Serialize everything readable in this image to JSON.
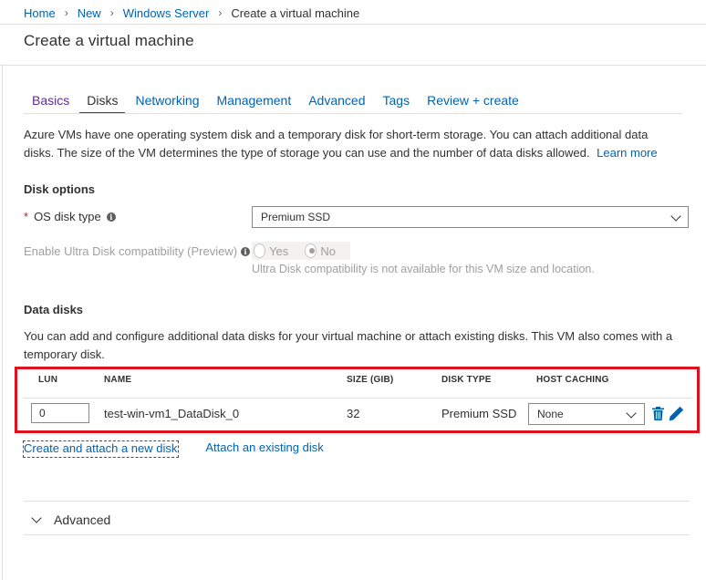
{
  "breadcrumb": {
    "items": [
      "Home",
      "New",
      "Windows Server"
    ],
    "current": "Create a virtual machine"
  },
  "page_title": "Create a virtual machine",
  "tabs": [
    {
      "label": "Basics"
    },
    {
      "label": "Disks",
      "active": true
    },
    {
      "label": "Networking"
    },
    {
      "label": "Management"
    },
    {
      "label": "Advanced"
    },
    {
      "label": "Tags"
    },
    {
      "label": "Review + create"
    }
  ],
  "intro": {
    "text": "Azure VMs have one operating system disk and a temporary disk for short-term storage. You can attach additional data disks. The size of the VM determines the type of storage you can use and the number of data disks allowed.",
    "learn_more": "Learn more"
  },
  "disk_options": {
    "title": "Disk options",
    "os_disk_type_label": "OS disk type",
    "os_disk_type_value": "Premium SSD",
    "ultra_label": "Enable Ultra Disk compatibility (Preview)",
    "ultra_yes": "Yes",
    "ultra_no": "No",
    "ultra_selected": "No",
    "ultra_note": "Ultra Disk compatibility is not available for this VM size and location."
  },
  "data_disks": {
    "title": "Data disks",
    "description": "You can add and configure additional data disks for your virtual machine or attach existing disks. This VM also comes with a temporary disk.",
    "columns": [
      "LUN",
      "NAME",
      "SIZE (GIB)",
      "DISK TYPE",
      "HOST CACHING"
    ],
    "rows": [
      {
        "lun": "0",
        "name": "test-win-vm1_DataDisk_0",
        "size": "32",
        "disk_type": "Premium SSD",
        "host_caching": "None"
      }
    ],
    "create_link": "Create and attach a new disk",
    "attach_link": "Attach an existing disk"
  },
  "advanced_section": {
    "label": "Advanced"
  },
  "colors": {
    "link": "#0063b1",
    "tab_accent": "#5c2d91",
    "highlight": "#e0101d",
    "required": "#a4262c"
  },
  "icons": {
    "delete": "trash-icon",
    "edit": "pencil-icon",
    "info": "info-icon"
  }
}
